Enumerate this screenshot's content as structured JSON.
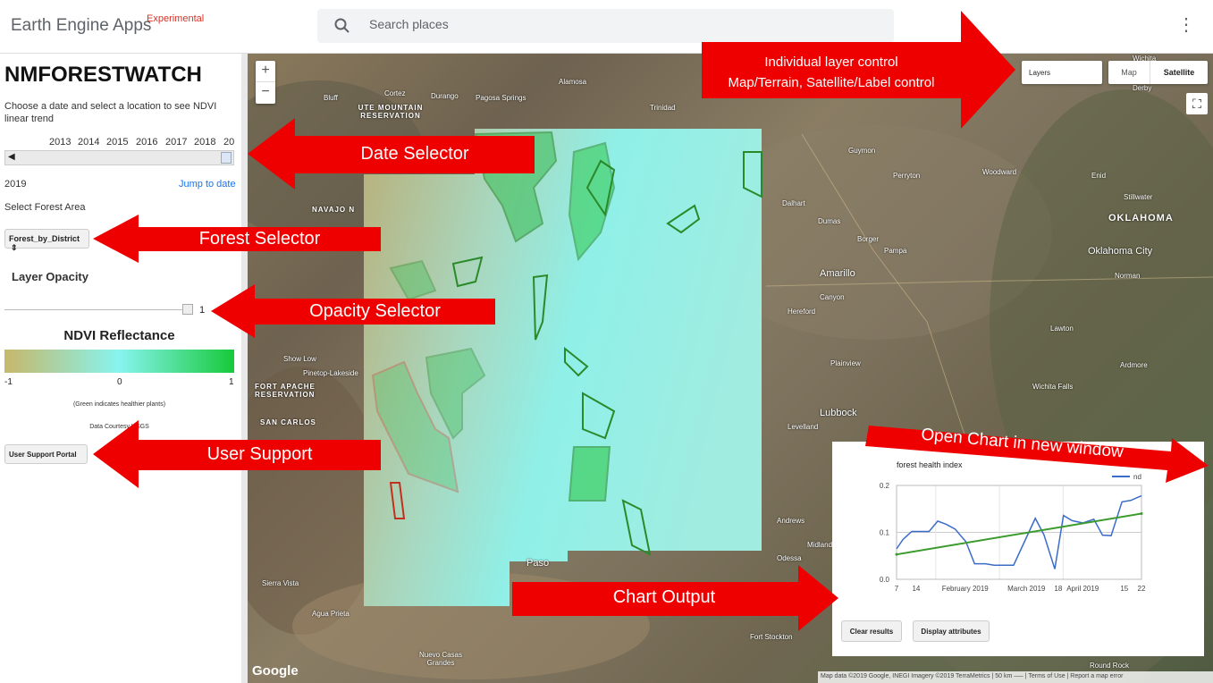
{
  "header": {
    "app_title": "Earth Engine Apps",
    "badge": "Experimental",
    "search_placeholder": "Search places"
  },
  "panel": {
    "title": "NMFORESTWATCH",
    "description": "Choose a date and select a location to see NDVI linear trend",
    "years": [
      "2013",
      "2014",
      "2015",
      "2016",
      "2017",
      "2018",
      "20"
    ],
    "date_value": "2019",
    "jump_to_date": "Jump to date",
    "forest_area_label": "Select Forest Area",
    "forest_select_value": "Forest_by_District",
    "opacity_label": "Layer Opacity",
    "opacity_value": "1",
    "ndvi_title": "NDVI Reflectance",
    "ndvi_min": "-1",
    "ndvi_mid": "0",
    "ndvi_max": "1",
    "ndvi_note": "(Green indicates healthier plants)",
    "ndvi_credit": "Data Courtesy USGS",
    "support_button": "User Support Portal"
  },
  "map": {
    "layers_label": "Layers",
    "map_type_map": "Map",
    "map_type_satellite": "Satellite",
    "google": "Google",
    "attribution": "Map data ©2019 Google, INEGI Imagery ©2019 TerraMetrics | 50 km ⎯⎯⎯ | Terms of Use | Report a map error",
    "labels": [
      {
        "text": "Durango",
        "cls": ""
      },
      {
        "text": "Alamosa",
        "cls": ""
      },
      {
        "text": "Trinidad",
        "cls": ""
      },
      {
        "text": "Cortez",
        "cls": ""
      },
      {
        "text": "Bluff",
        "cls": ""
      },
      {
        "text": "Pagosa Springs",
        "cls": ""
      },
      {
        "text": "UTE MOUNTAIN RESERVATION",
        "cls": "big"
      },
      {
        "text": "NAVAJO N",
        "cls": "big"
      },
      {
        "text": "FORT APACHE RESERVATION",
        "cls": "big"
      },
      {
        "text": "SAN CARLOS",
        "cls": "big"
      },
      {
        "text": "Show Low",
        "cls": ""
      },
      {
        "text": "Pinetop-Lakeside",
        "cls": ""
      },
      {
        "text": "Sierra Vista",
        "cls": ""
      },
      {
        "text": "Agua Prieta",
        "cls": ""
      },
      {
        "text": "Nuevo Casas Grandes",
        "cls": ""
      },
      {
        "text": "Paso",
        "cls": "city"
      },
      {
        "text": "Guymon",
        "cls": ""
      },
      {
        "text": "Perryton",
        "cls": ""
      },
      {
        "text": "Woodward",
        "cls": ""
      },
      {
        "text": "Enid",
        "cls": ""
      },
      {
        "text": "Stillwater",
        "cls": ""
      },
      {
        "text": "OKLAHOMA",
        "cls": "big"
      },
      {
        "text": "Oklahoma City",
        "cls": "city"
      },
      {
        "text": "Norman",
        "cls": ""
      },
      {
        "text": "Dalhart",
        "cls": ""
      },
      {
        "text": "Dumas",
        "cls": ""
      },
      {
        "text": "Borger",
        "cls": ""
      },
      {
        "text": "Pampa",
        "cls": ""
      },
      {
        "text": "Amarillo",
        "cls": "city"
      },
      {
        "text": "Canyon",
        "cls": ""
      },
      {
        "text": "Hereford",
        "cls": ""
      },
      {
        "text": "Plainview",
        "cls": ""
      },
      {
        "text": "Lawton",
        "cls": ""
      },
      {
        "text": "Wichita Falls",
        "cls": ""
      },
      {
        "text": "Ardmore",
        "cls": ""
      },
      {
        "text": "Lubbock",
        "cls": "city"
      },
      {
        "text": "Levelland",
        "cls": ""
      },
      {
        "text": "Andrews",
        "cls": ""
      },
      {
        "text": "Midland",
        "cls": ""
      },
      {
        "text": "Odessa",
        "cls": ""
      },
      {
        "text": "Fort Stockton",
        "cls": ""
      },
      {
        "text": "Round Rock",
        "cls": ""
      },
      {
        "text": "Derby",
        "cls": ""
      },
      {
        "text": "Wichita",
        "cls": ""
      }
    ]
  },
  "chart": {
    "chart_data": {
      "type": "line",
      "title": "forest health index",
      "xlabel": "",
      "ylabel": "",
      "ylim": [
        0.0,
        0.2
      ],
      "yticks": [
        "0.2",
        "0.1",
        "0.0"
      ],
      "xticks": [
        "7",
        "14",
        "February 2019",
        "March 2019",
        "18",
        "April 2019",
        "15",
        "22"
      ],
      "legend_position": "top-right",
      "series": [
        {
          "name": "nd",
          "color": "#3b6cc9",
          "x": [
            "2019-01-01",
            "2019-01-04",
            "2019-01-08",
            "2019-01-11",
            "2019-01-16",
            "2019-01-20",
            "2019-01-24",
            "2019-01-28",
            "2019-02-02",
            "2019-02-06",
            "2019-02-11",
            "2019-02-15",
            "2019-02-20",
            "2019-02-24",
            "2019-03-01",
            "2019-03-06",
            "2019-03-10",
            "2019-03-15",
            "2019-03-19",
            "2019-03-23",
            "2019-03-28",
            "2019-04-02",
            "2019-04-06",
            "2019-04-10",
            "2019-04-15",
            "2019-04-19",
            "2019-04-24"
          ],
          "y": [
            0.065,
            0.085,
            0.102,
            0.102,
            0.102,
            0.124,
            0.117,
            0.107,
            0.08,
            0.033,
            0.033,
            0.03,
            0.03,
            0.03,
            0.08,
            0.13,
            0.095,
            0.022,
            0.136,
            0.125,
            0.12,
            0.128,
            0.094,
            0.093,
            0.165,
            0.168,
            0.178
          ]
        },
        {
          "name": "",
          "color": "#3b9b2e",
          "x": [
            "2019-01-01",
            "2019-04-24"
          ],
          "y": [
            0.053,
            0.14
          ]
        }
      ]
    },
    "clear_results": "Clear results",
    "display_attributes": "Display attributes"
  },
  "annotations": [
    {
      "text": "Individual layer control",
      "text2": "Map/Terrain, Satellite/Label control"
    },
    {
      "text": "Date Selector"
    },
    {
      "text": "Forest Selector"
    },
    {
      "text": "Opacity Selector"
    },
    {
      "text": "User Support"
    },
    {
      "text": "Chart Output"
    },
    {
      "text": "Open Chart in new window"
    }
  ],
  "colors": {
    "annotation_red": "#ee0000",
    "ndvi_low": "#c7b76a",
    "ndvi_mid": "#87f4ef",
    "ndvi_high": "#17c93a"
  }
}
